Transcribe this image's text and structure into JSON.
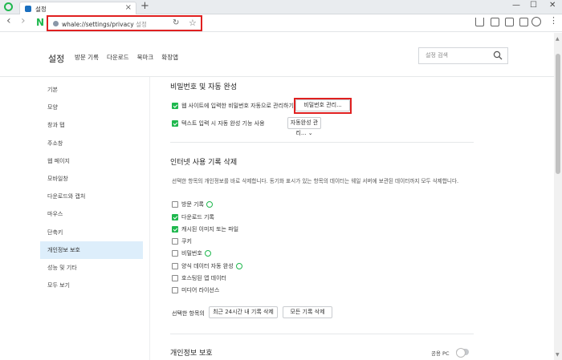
{
  "tab": {
    "title": "설정",
    "close": "×",
    "new_tab": "+"
  },
  "window": {
    "minimize": "—",
    "maximize": "☐",
    "close": "✕"
  },
  "toolbar": {
    "back": "‹",
    "forward": "›",
    "logo": "N",
    "url_main": "whale://settings/privacy",
    "url_suffix": "설정",
    "reload": "↻",
    "star": "☆",
    "more": "⋮"
  },
  "header": {
    "title": "설정",
    "nav": [
      "방문 기록",
      "다운로드",
      "북마크",
      "확장앱"
    ],
    "search_placeholder": "설정 검색"
  },
  "sidebar": {
    "items": [
      {
        "label": "기본"
      },
      {
        "label": "모양"
      },
      {
        "label": "창과 탭"
      },
      {
        "label": "주소창"
      },
      {
        "label": "웹 페이지"
      },
      {
        "label": "모바일창"
      },
      {
        "label": "다운로드와 캡처"
      },
      {
        "label": "마우스"
      },
      {
        "label": "단축키"
      },
      {
        "label": "개인정보 보호"
      },
      {
        "label": "성능 및 기타"
      },
      {
        "label": "모두 보기"
      }
    ],
    "active_index": 9
  },
  "section_password": {
    "title": "비밀번호 및 자동 완성",
    "save_password_label": "웹 사이트에 입력한 비밀번호 자동으로 관리하기",
    "save_password_checked": true,
    "manage_password_button": "비밀번호 관리...",
    "autofill_label": "텍스트 입력 시 자동 완성 기능 사용",
    "autofill_checked": true,
    "manage_autofill_button": "자동완성 관리..."
  },
  "section_history": {
    "title": "인터넷 사용 기록 삭제",
    "description": "선택한 항목의 개인정보를 바로 삭제합니다. 동기화 표시가 있는 항목의 데이터는 웨일 서버에 보관된 데이터까지 모두 삭제합니다.",
    "items": [
      {
        "label": "방문 기록",
        "checked": false,
        "sync": true
      },
      {
        "label": "다운로드 기록",
        "checked": true,
        "sync": false
      },
      {
        "label": "캐시된 이미지 또는 파일",
        "checked": true,
        "sync": false
      },
      {
        "label": "쿠키",
        "checked": false,
        "sync": false
      },
      {
        "label": "비밀번호",
        "checked": false,
        "sync": true
      },
      {
        "label": "양식 데이터 자동 완성",
        "checked": false,
        "sync": true
      },
      {
        "label": "호스팅된 앱 데이터",
        "checked": false,
        "sync": false
      },
      {
        "label": "미디어 라이선스",
        "checked": false,
        "sync": false
      }
    ],
    "selected_label": "선택한 항목의",
    "delete_24h_button": "최근 24시간 내 기록 삭제",
    "delete_all_button": "모든 기록 삭제"
  },
  "section_privacy": {
    "title": "개인정보 보호",
    "shared_pc_label": "공용 PC",
    "shared_pc_enabled": false
  },
  "colors": {
    "accent": "#1fb84e",
    "highlight": "#e02020",
    "active_bg": "#ddeefb"
  }
}
